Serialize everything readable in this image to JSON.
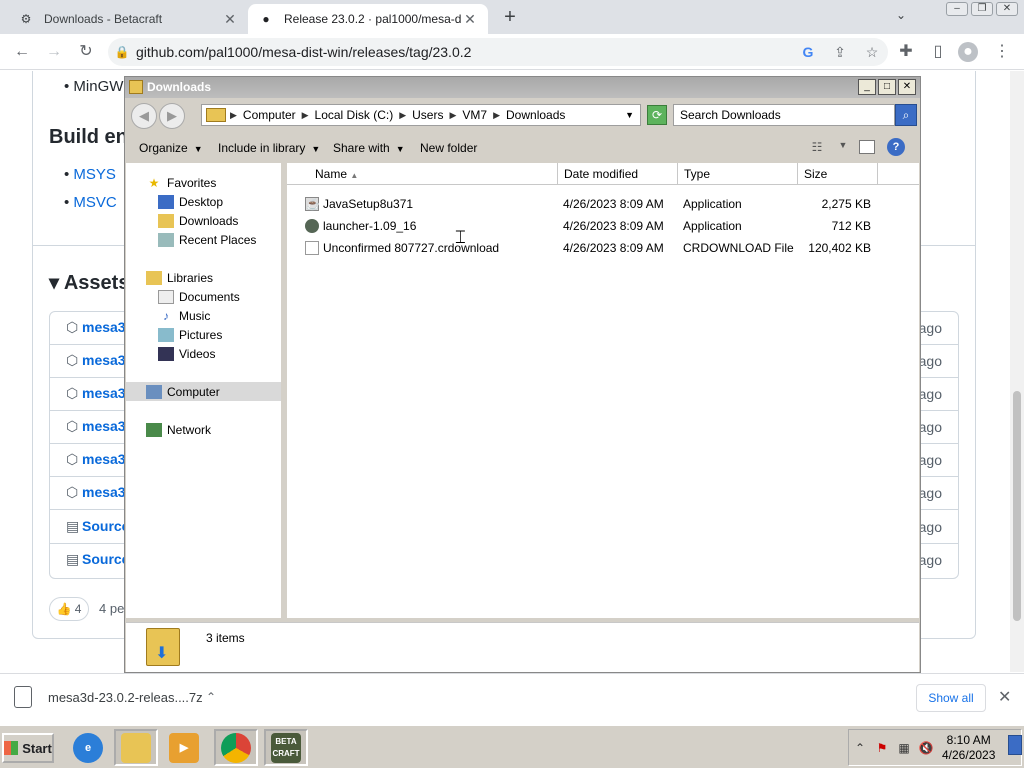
{
  "browser": {
    "tabs": [
      {
        "title": "Downloads - Betacraft",
        "active": false
      },
      {
        "title": "Release 23.0.2 · pal1000/mesa-dist",
        "active": true
      }
    ],
    "url": "github.com/pal1000/mesa-dist-win/releases/tag/23.0.2"
  },
  "github": {
    "bullet_top": "MinGW",
    "heading_build": "Build en",
    "links": [
      "MSYS",
      "MSVC"
    ],
    "assets_heading": "Assets",
    "asset_rows": [
      {
        "name": "mesa3",
        "ago": "ago"
      },
      {
        "name": "mesa3",
        "ago": "ago"
      },
      {
        "name": "mesa3",
        "ago": "ago"
      },
      {
        "name": "mesa3",
        "ago": "ago"
      },
      {
        "name": "mesa3",
        "ago": "ago"
      },
      {
        "name": "mesa3",
        "ago": "ago"
      },
      {
        "name": "Source",
        "ago": "ago"
      },
      {
        "name": "Source",
        "ago": "ago"
      }
    ],
    "reaction_count": "4",
    "people_partial": "4 pe"
  },
  "explorer": {
    "title": "Downloads",
    "breadcrumbs": [
      "Computer",
      "Local Disk (C:)",
      "Users",
      "VM7",
      "Downloads"
    ],
    "search_placeholder": "Search Downloads",
    "commands": {
      "organize": "Organize",
      "include_in_library": "Include in library",
      "share_with": "Share with",
      "new_folder": "New folder"
    },
    "nav": {
      "favorites": "Favorites",
      "desktop": "Desktop",
      "downloads": "Downloads",
      "recent_places": "Recent Places",
      "libraries": "Libraries",
      "documents": "Documents",
      "music": "Music",
      "pictures": "Pictures",
      "videos": "Videos",
      "computer": "Computer",
      "network": "Network"
    },
    "columns": {
      "name": "Name",
      "date": "Date modified",
      "type": "Type",
      "size": "Size"
    },
    "files": [
      {
        "name": "JavaSetup8u371",
        "date": "4/26/2023 8:09 AM",
        "type": "Application",
        "size": "2,275 KB"
      },
      {
        "name": "launcher-1.09_16",
        "date": "4/26/2023 8:09 AM",
        "type": "Application",
        "size": "712 KB"
      },
      {
        "name": "Unconfirmed 807727.crdownload",
        "date": "4/26/2023 8:09 AM",
        "type": "CRDOWNLOAD File",
        "size": "120,402 KB"
      }
    ],
    "status": "3 items"
  },
  "download_bar": {
    "file": "mesa3d-23.0.2-releas....7z",
    "show_all": "Show all"
  },
  "taskbar": {
    "start": "Start",
    "time": "8:10 AM",
    "date": "4/26/2023"
  }
}
